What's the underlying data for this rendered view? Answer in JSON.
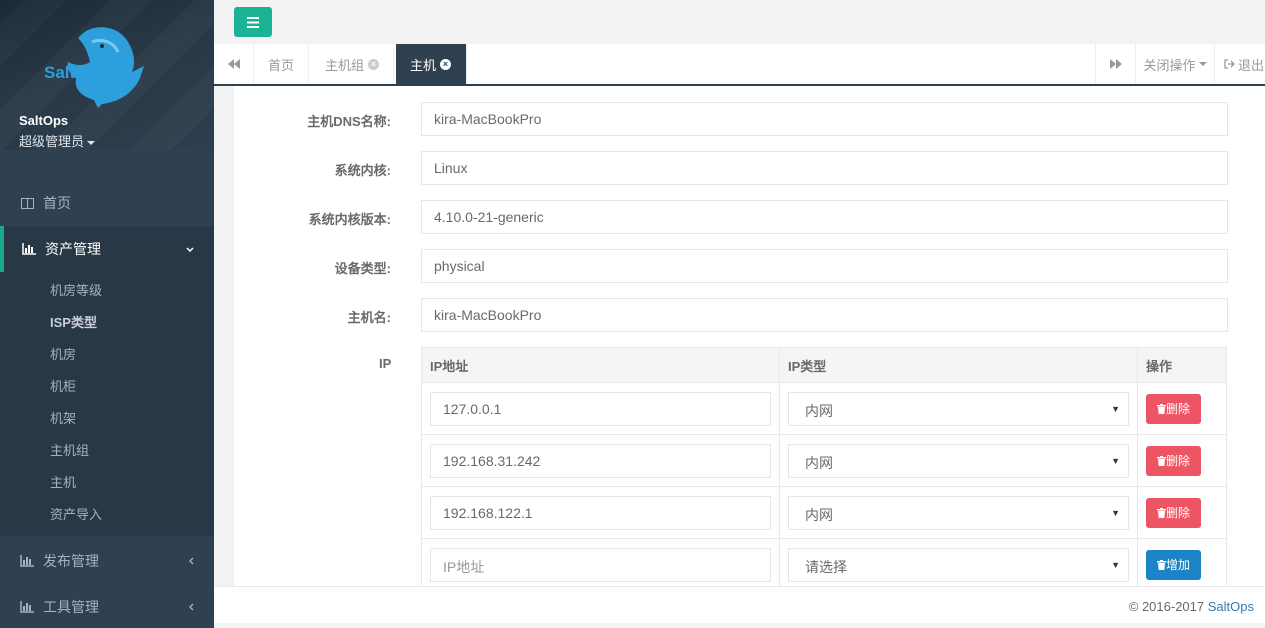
{
  "app": {
    "brand": "SaltOps"
  },
  "user": {
    "name": "SaltOps",
    "role": "超级管理员"
  },
  "sidebar": {
    "items": [
      {
        "label": "首页",
        "icon": "columns-icon"
      },
      {
        "label": "资产管理",
        "icon": "bar-chart-icon"
      },
      {
        "label": "发布管理",
        "icon": "bar-chart-icon"
      },
      {
        "label": "工具管理",
        "icon": "bar-chart-icon"
      }
    ],
    "submenu": [
      "机房等级",
      "ISP类型",
      "机房",
      "机柜",
      "机架",
      "主机组",
      "主机",
      "资产导入"
    ]
  },
  "tabs": [
    {
      "label": "首页"
    },
    {
      "label": "主机组"
    },
    {
      "label": "主机"
    }
  ],
  "tab_actions": {
    "close_ops": "关闭操作",
    "logout": "退出"
  },
  "form": {
    "dns_label": "主机DNS名称:",
    "dns_value": "kira-MacBookPro",
    "kernel_label": "系统内核:",
    "kernel_value": "Linux",
    "kernel_version_label": "系统内核版本:",
    "kernel_version_value": "4.10.0-21-generic",
    "device_type_label": "设备类型:",
    "device_type_value": "physical",
    "hostname_label": "主机名:",
    "hostname_value": "kira-MacBookPro",
    "ip_label": "IP"
  },
  "ip_table": {
    "headers": [
      "IP地址",
      "IP类型",
      "操作"
    ],
    "rows": [
      {
        "ip": "127.0.0.1",
        "type": "内网",
        "action": "删除"
      },
      {
        "ip": "192.168.31.242",
        "type": "内网",
        "action": "删除"
      },
      {
        "ip": "192.168.122.1",
        "type": "内网",
        "action": "删除"
      }
    ],
    "new_row": {
      "ip_placeholder": "IP地址",
      "type_placeholder": "请选择",
      "action": "增加"
    }
  },
  "footer": {
    "copyright": "© 2016-2017 ",
    "link": "SaltOps"
  },
  "colors": {
    "sidebar": "#2f4050",
    "accent": "#1ab394",
    "danger": "#ed5565",
    "primary": "#1c84c6"
  }
}
